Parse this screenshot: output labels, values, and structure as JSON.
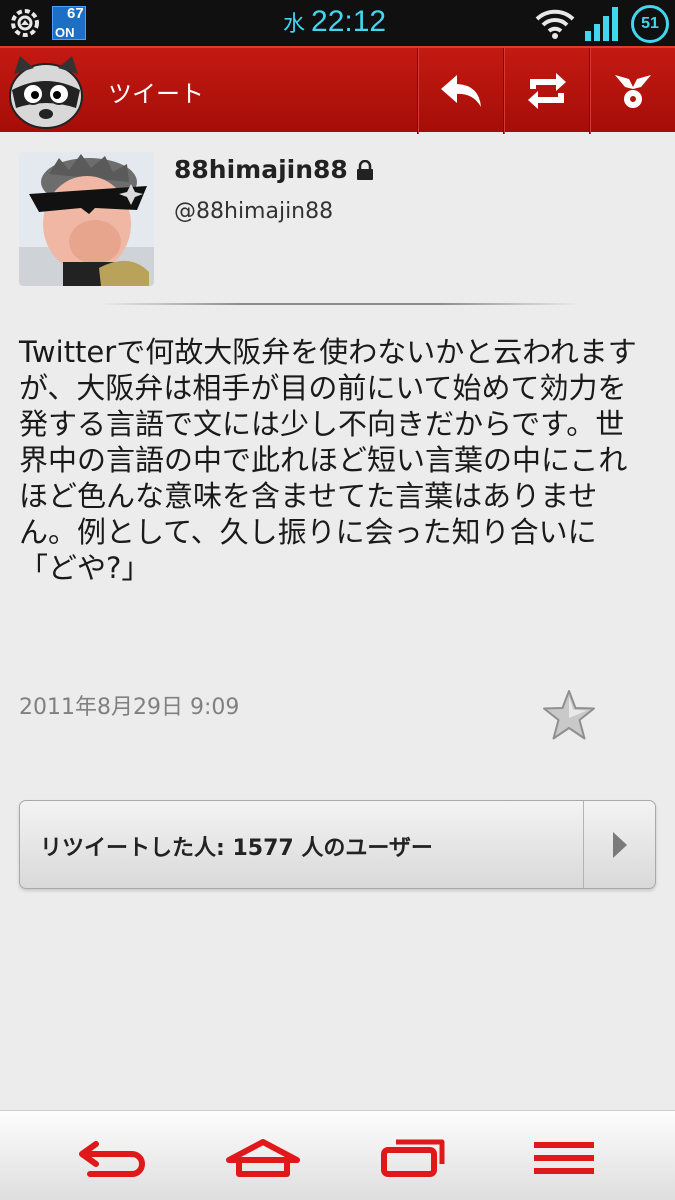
{
  "status_bar": {
    "temperature": "67",
    "temperature_badge": "ON",
    "day": "水",
    "time": "22:12",
    "battery": "51"
  },
  "app_bar": {
    "title": "ツイート",
    "icons": [
      "raccoon-logo-icon",
      "reply-icon",
      "retweet-icon",
      "more-actions-icon"
    ]
  },
  "tweet": {
    "display_name": "88himajin88",
    "handle": "@88himajin88",
    "protected": true,
    "text": "Twitterで何故大阪弁を使わないかと云われますが、大阪弁は相手が目の前にいて始めて効力を発する言語で文には少し不向きだからです。世界中の言語の中で此れほど短い言葉の中にこれほど色んな意味を含ませてた言葉はありません。例として、久し振りに会った知り合いに「どや?」",
    "timestamp": "2011年8月29日 9:09"
  },
  "retweeters": {
    "label": "リツイートした人: 1577 人のユーザー"
  },
  "nav_bar": {
    "icons": [
      "back-icon",
      "home-icon",
      "recent-apps-icon",
      "menu-icon"
    ]
  },
  "colors": {
    "app_bar": "#b3140c",
    "status_accent": "#41d7ee",
    "nav_icons": "#e0181a",
    "background": "#ececec"
  }
}
